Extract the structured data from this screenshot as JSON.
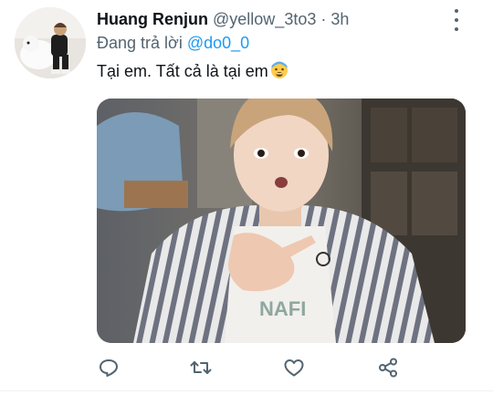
{
  "tweet": {
    "display_name": "Huang Renjun",
    "handle": "@yellow_3to3",
    "separator": "·",
    "time": "3h",
    "reply_prefix": "Đang trả lời",
    "reply_to": "@do0_0",
    "text": "Tại em. Tất cả là tại em",
    "emoji": "fearful-face-emoji"
  },
  "avatar": {
    "alt": "profile-photo"
  },
  "media": {
    "description_icon": "photo"
  },
  "actions": [
    {
      "name": "reply",
      "icon": "reply-icon"
    },
    {
      "name": "retweet",
      "icon": "retweet-icon"
    },
    {
      "name": "like",
      "icon": "heart-icon"
    },
    {
      "name": "share",
      "icon": "share-icon"
    }
  ],
  "colors": {
    "text": "#0f1419",
    "secondary": "#536471",
    "accent": "#1d9bf0",
    "divider": "#eff3f4"
  }
}
